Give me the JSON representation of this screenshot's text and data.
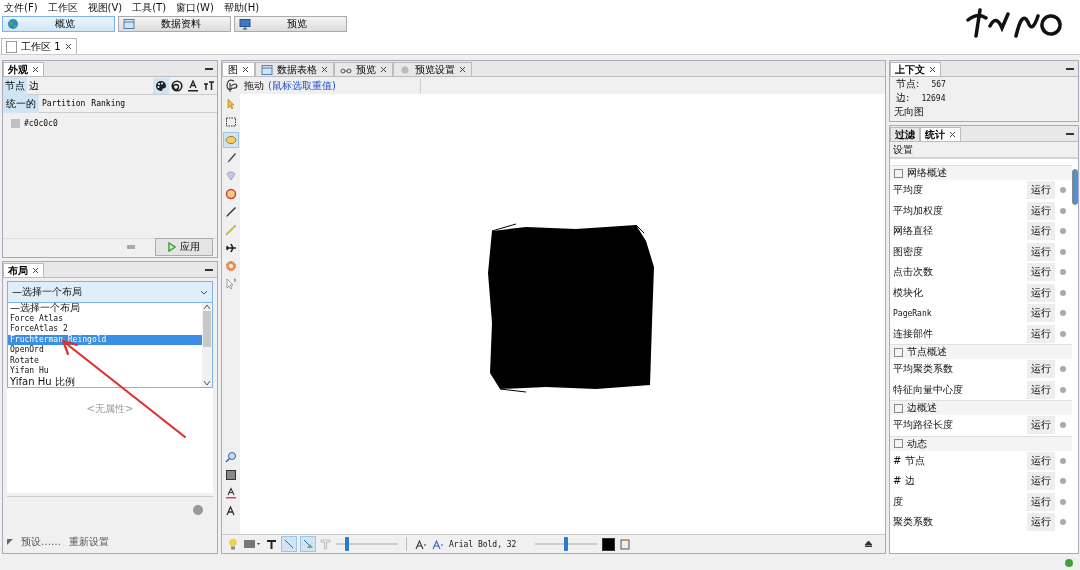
{
  "menu": [
    "文件(F)",
    "工作区",
    "视图(V)",
    "工具(T)",
    "窗口(W)",
    "帮助(H)"
  ],
  "modes": [
    {
      "label": "概览",
      "kind": "globe",
      "selected": true
    },
    {
      "label": "数据资料",
      "kind": "table",
      "selected": false
    },
    {
      "label": "预览",
      "kind": "monitor",
      "selected": false
    }
  ],
  "workspace_tabs": [
    {
      "label": "工作区 1"
    }
  ],
  "appearance": {
    "title": "外观",
    "element_tabs": [
      {
        "label": "节点",
        "selected": true
      },
      {
        "label": "边",
        "selected": false
      }
    ],
    "attribute_tools": [
      {
        "kind": "palette",
        "selected": true
      },
      {
        "kind": "size",
        "selected": false
      },
      {
        "kind": "label-color",
        "selected": false
      },
      {
        "kind": "label-size",
        "selected": false
      }
    ],
    "modes": [
      {
        "label": "统一的",
        "selected": true
      },
      {
        "label": "Partition",
        "selected": false
      },
      {
        "label": "Ranking",
        "selected": false
      }
    ],
    "swatch": {
      "label": "#c0c0c0",
      "color": "#c0c0c0"
    },
    "apply": "应用"
  },
  "layout": {
    "title": "布局",
    "dropdown": "—选择一个布局",
    "options": [
      {
        "label": "—选择一个布局",
        "selected": false
      },
      {
        "label": "Force Atlas",
        "selected": false
      },
      {
        "label": "ForceAtlas 2",
        "selected": false
      },
      {
        "label": "Fruchterman Reingold",
        "selected": true
      },
      {
        "label": "OpenOrd",
        "selected": false
      },
      {
        "label": "Rotate",
        "selected": false
      },
      {
        "label": "Yifan Hu",
        "selected": false
      },
      {
        "label": "Yifan Hu 比例",
        "selected": false
      }
    ],
    "properties_empty": "<无属性>",
    "presets": "预设……",
    "reset": "重新设置"
  },
  "graph_tabs": [
    {
      "label": "图",
      "kind": "none",
      "selected": true
    },
    {
      "label": "数据表格",
      "kind": "table",
      "selected": false
    },
    {
      "label": "预览",
      "kind": "glasses",
      "selected": false
    },
    {
      "label": "预览设置",
      "kind": "dot",
      "selected": false
    }
  ],
  "graph_toolbar": {
    "label": "拖动",
    "hint": "(鼠标选取重值)"
  },
  "tools": [
    {
      "kind": "pointer",
      "selected": false
    },
    {
      "kind": "rect",
      "selected": false
    },
    {
      "kind": "lasso",
      "selected": true
    },
    {
      "kind": "brush",
      "selected": false
    },
    {
      "kind": "diamond",
      "selected": false
    },
    {
      "kind": "wheel",
      "selected": false
    },
    {
      "kind": "pencil",
      "selected": false
    },
    {
      "kind": "marker",
      "selected": false
    },
    {
      "kind": "plane",
      "selected": false
    },
    {
      "kind": "flower",
      "selected": false
    },
    {
      "kind": "cursor-help",
      "selected": false
    }
  ],
  "lower_tools": [
    {
      "kind": "zoom"
    },
    {
      "kind": "square"
    },
    {
      "kind": "text-color"
    },
    {
      "kind": "text-size"
    }
  ],
  "bottom_toolbar": {
    "edge_buttons": [
      {
        "kind": "edge",
        "selected": true
      },
      {
        "kind": "edge-color",
        "selected": true
      }
    ],
    "edge_weight": {
      "level": 0.17
    },
    "font": "Arial Bold, 32",
    "label_size": {
      "level": 0.49
    }
  },
  "context": {
    "title": "上下文",
    "nodes_label": "节点:",
    "nodes": "567",
    "edges_label": "边:",
    "edges": "12694",
    "graph_type": "无向图"
  },
  "statistics": {
    "tabs": [
      {
        "label": "过滤",
        "selected": false
      },
      {
        "label": "统计",
        "selected": true
      }
    ],
    "settings": "设置",
    "items": [
      {
        "kind": "section",
        "label": "网络概述"
      },
      {
        "kind": "stat",
        "label": "平均度",
        "run": "运行"
      },
      {
        "kind": "stat",
        "label": "平均加权度",
        "run": "运行"
      },
      {
        "kind": "stat",
        "label": "网络直径",
        "run": "运行"
      },
      {
        "kind": "stat",
        "label": "图密度",
        "run": "运行"
      },
      {
        "kind": "stat",
        "label": "点击次数",
        "run": "运行"
      },
      {
        "kind": "stat",
        "label": "模块化",
        "run": "运行"
      },
      {
        "kind": "stat",
        "label": "PageRank",
        "run": "运行"
      },
      {
        "kind": "stat",
        "label": "连接部件",
        "run": "运行"
      },
      {
        "kind": "section",
        "label": "节点概述"
      },
      {
        "kind": "stat",
        "label": "平均聚类系数",
        "run": "运行"
      },
      {
        "kind": "stat",
        "label": "特征向量中心度",
        "run": "运行"
      },
      {
        "kind": "section",
        "label": "边概述"
      },
      {
        "kind": "stat",
        "label": "平均路径长度",
        "run": "运行"
      },
      {
        "kind": "section",
        "label": "动态"
      },
      {
        "kind": "stat",
        "label": "# 节点",
        "run": "运行"
      },
      {
        "kind": "stat",
        "label": "# 边",
        "run": "运行"
      },
      {
        "kind": "stat",
        "label": "度",
        "run": "运行"
      },
      {
        "kind": "stat",
        "label": "聚类系数",
        "run": "运行"
      }
    ]
  }
}
